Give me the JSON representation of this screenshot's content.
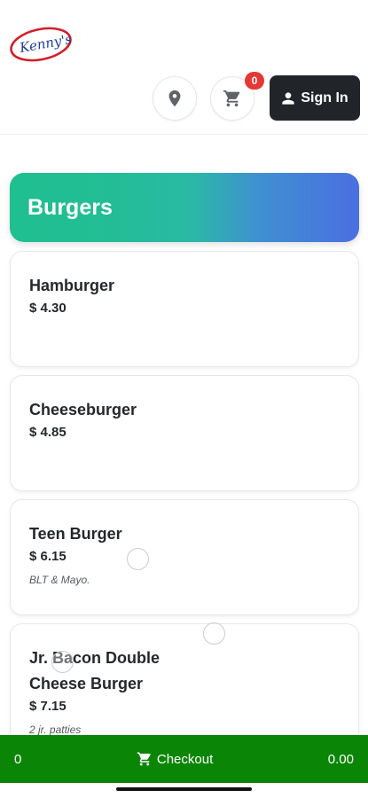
{
  "header": {
    "logo_text": "Kenny's",
    "cart_count": "0",
    "signin_label": "Sign In",
    "icons": {
      "location": "location-pin-icon",
      "cart": "shopping-cart-icon",
      "user": "user-icon"
    }
  },
  "category": {
    "title": "Burgers",
    "gradient_colors": [
      "#1fbf8f",
      "#4b6fe0"
    ]
  },
  "items": [
    {
      "name": "Hamburger",
      "price": "$ 4.30",
      "description": ""
    },
    {
      "name": "Cheeseburger",
      "price": "$ 4.85",
      "description": ""
    },
    {
      "name": "Teen Burger",
      "price": "$ 6.15",
      "description": "BLT & Mayo."
    },
    {
      "name": "Jr. Bacon Double Cheese Burger",
      "price": "$ 7.15",
      "description": "2 jr. patties"
    }
  ],
  "checkout": {
    "count": "0",
    "label": "Checkout",
    "total": "0.00",
    "color": "#0b8506"
  },
  "colors": {
    "badge": "#e53935",
    "signin_bg": "#212529",
    "logo_red": "#d21f2b",
    "logo_blue": "#1d3f9a"
  }
}
